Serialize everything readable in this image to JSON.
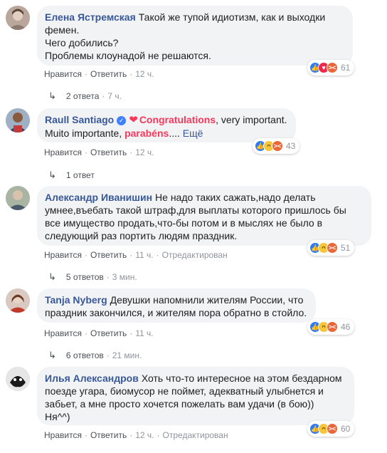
{
  "comments": [
    {
      "author": "Елена Ястремская",
      "text_lines": [
        "Такой же тупой идиотизм, как и выходки",
        "фемен.",
        "Чего добились?",
        "Проблемы клоунадой не решаются."
      ],
      "actions": {
        "like": "Нравится",
        "reply": "Ответить",
        "time": "12 ч."
      },
      "reactions": {
        "icons": [
          "like",
          "love",
          "angry"
        ],
        "count": "61"
      },
      "replies": {
        "label": "2 ответа",
        "time": "7 ч."
      }
    },
    {
      "author": "Raull Santiago",
      "verified": true,
      "highlight1": "Congratulations",
      "text1": ", very important.",
      "text2": "Muito importante, ",
      "highlight2": "parabéns",
      "text3": ".... ",
      "more": "Ещё",
      "actions": {
        "like": "Нравится",
        "reply": "Ответить",
        "time": "12 ч."
      },
      "reactions": {
        "icons": [
          "like",
          "haha",
          "angry"
        ],
        "count": "43"
      },
      "replies": {
        "label": "1 ответ"
      }
    },
    {
      "author": "Александр Иванишин",
      "text_lines": [
        "Не надо таких сажать,надо делать",
        "умнее,въебать такой штраф,для выплаты которого пришлось бы",
        "все имущество продать,что-бы потом и в мыслях не было в",
        "следующий раз портить людям праздник."
      ],
      "actions": {
        "like": "Нравится",
        "reply": "Ответить",
        "time": "11 ч.",
        "edited": "Отредактирован"
      },
      "reactions": {
        "icons": [
          "like",
          "haha",
          "angry"
        ],
        "count": "51"
      },
      "replies": {
        "label": "5 ответов",
        "time": "3 мин."
      }
    },
    {
      "author": "Tanja Nyberg",
      "text_lines": [
        "Девушки напомнили жителям России, что",
        "праздник закончился, и жителям пора обратно в стойло."
      ],
      "actions": {
        "like": "Нравится",
        "reply": "Ответить",
        "time": "11 ч."
      },
      "reactions": {
        "icons": [
          "like",
          "haha",
          "angry"
        ],
        "count": "46"
      },
      "replies": {
        "label": "6 ответов",
        "time": "21 мин."
      }
    },
    {
      "author": "Илья Александров",
      "text_lines": [
        "Хоть что-то интересное на этом бездарном",
        "поезде угара, биомусор не поймет, адекватный улыбнется и",
        "забьет, а мне просто хочется пожелать вам удачи (в бою))",
        "Ня^^)"
      ],
      "actions": {
        "like": "Нравится",
        "reply": "Ответить",
        "time": "12 ч.",
        "edited": "Отредактирован"
      },
      "reactions": {
        "icons": [
          "like",
          "haha",
          "angry"
        ],
        "count": "60"
      }
    }
  ],
  "colors": {
    "author": "#385898",
    "bubble": "#f2f3f5",
    "highlight": "#f7385b",
    "like": "#2e7cf6"
  }
}
